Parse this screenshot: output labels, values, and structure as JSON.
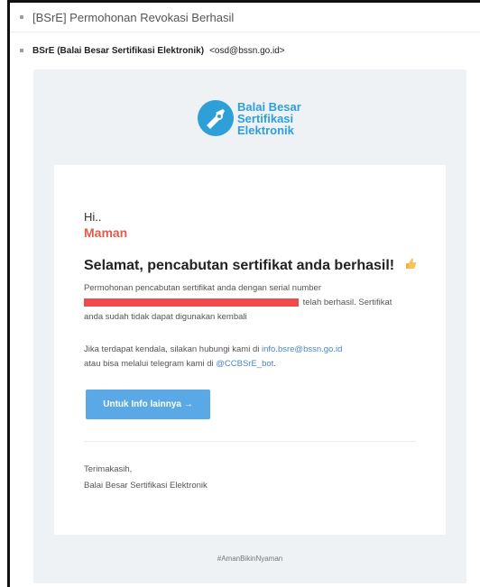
{
  "subject": {
    "text": "[BSrE] Permohonan Revokasi Berhasil"
  },
  "sender": {
    "name": "BSrE (Balai Besar Sertifikasi Elektronik)",
    "email": "<osd@bssn.go.id>"
  },
  "logo": {
    "line1": "Balai Besar",
    "line2": "Sertifikasi",
    "line3": "Elektronik"
  },
  "greeting": {
    "hi": "Hi..",
    "name": "Maman"
  },
  "headline": {
    "text": "Selamat, pencabutan sertifikat anda berhasil!"
  },
  "message": {
    "line1": "Permohonan pencabutan sertifikat anda dengan serial number",
    "line2_suffix": "telah berhasil. Sertifikat",
    "line3": "anda sudah tidak dapat digunakan kembali"
  },
  "contact": {
    "prefix": "Jika terdapat kendala, silakan hubungi kami di",
    "email": "info.bsre@bssn.go.id",
    "mid": "atau bisa melalui telegram kami di",
    "telegram": "@CCBSrE_bot",
    "suffix": "."
  },
  "button": {
    "label": "Untuk Info lainnya →"
  },
  "closing": {
    "line1": "Terimakasih,",
    "line2": "Balai Besar Sertifikasi Elektronik"
  },
  "footer": {
    "hashtag": "#AmanBikinNyaman"
  },
  "colors": {
    "accent": "#2f9fd8",
    "name": "#e65a4a",
    "button": "#5aa9e6",
    "redaction": "#f04a4a"
  },
  "icons": {
    "hand": "thumbs-up-hand-icon",
    "logo": "bsre-logo-icon",
    "subject_bullet": "square-bullet-icon",
    "sender_bullet": "square-bullet-icon"
  }
}
